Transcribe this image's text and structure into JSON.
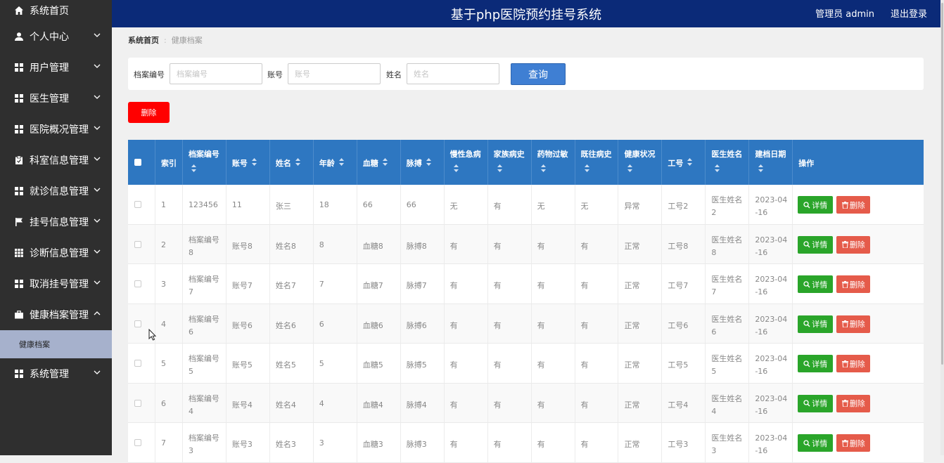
{
  "app": {
    "title": "基于php医院预约挂号系统",
    "user_label": "管理员 admin",
    "logout_label": "退出登录"
  },
  "sidebar": {
    "items": [
      {
        "label": "系统首页",
        "icon": "home-icon"
      },
      {
        "label": "个人中心",
        "icon": "user-icon"
      },
      {
        "label": "用户管理",
        "icon": "grid-icon"
      },
      {
        "label": "医生管理",
        "icon": "grid-icon"
      },
      {
        "label": "医院概况管理",
        "icon": "grid-icon"
      },
      {
        "label": "科室信息管理",
        "icon": "clipboard-icon"
      },
      {
        "label": "就诊信息管理",
        "icon": "grid-icon"
      },
      {
        "label": "挂号信息管理",
        "icon": "flag-icon"
      },
      {
        "label": "诊断信息管理",
        "icon": "table-icon"
      },
      {
        "label": "取消挂号管理",
        "icon": "grid-icon"
      },
      {
        "label": "健康档案管理",
        "icon": "briefcase-icon"
      },
      {
        "label": "系统管理",
        "icon": "grid-icon"
      }
    ],
    "sub_item": "健康档案"
  },
  "breadcrumb": {
    "home": "系统首页",
    "current": "健康档案"
  },
  "search": {
    "label1": "档案编号",
    "placeholder1": "档案编号",
    "label2": "账号",
    "placeholder2": "账号",
    "label3": "姓名",
    "placeholder3": "姓名",
    "query_label": "查询"
  },
  "delete_label": "删除",
  "table": {
    "headers": [
      "索引",
      "档案编号",
      "账号",
      "姓名",
      "年龄",
      "血糖",
      "脉搏",
      "慢性急病",
      "家族病史",
      "药物过敏",
      "既往病史",
      "健康状况",
      "工号",
      "医生姓名",
      "建档日期",
      "操作"
    ],
    "detail_label": "详情",
    "delete_label": "删除",
    "rows": [
      {
        "idx": "1",
        "archive_no": "123456",
        "account": "11",
        "name": "张三",
        "age": "18",
        "sugar": "66",
        "pulse": "66",
        "chronic": "无",
        "family": "有",
        "allergy": "无",
        "history": "无",
        "health": "异常",
        "work_no": "工号2",
        "doctor": "医生姓名\n2",
        "date": "2023-04\n-16"
      },
      {
        "idx": "2",
        "archive_no": "档案编号\n8",
        "account": "账号8",
        "name": "姓名8",
        "age": "8",
        "sugar": "血糖8",
        "pulse": "脉搏8",
        "chronic": "有",
        "family": "有",
        "allergy": "有",
        "history": "有",
        "health": "正常",
        "work_no": "工号8",
        "doctor": "医生姓名\n8",
        "date": "2023-04\n-16"
      },
      {
        "idx": "3",
        "archive_no": "档案编号\n7",
        "account": "账号7",
        "name": "姓名7",
        "age": "7",
        "sugar": "血糖7",
        "pulse": "脉搏7",
        "chronic": "有",
        "family": "有",
        "allergy": "有",
        "history": "有",
        "health": "正常",
        "work_no": "工号7",
        "doctor": "医生姓名\n7",
        "date": "2023-04\n-16"
      },
      {
        "idx": "4",
        "archive_no": "档案编号\n6",
        "account": "账号6",
        "name": "姓名6",
        "age": "6",
        "sugar": "血糖6",
        "pulse": "脉搏6",
        "chronic": "有",
        "family": "有",
        "allergy": "有",
        "history": "有",
        "health": "正常",
        "work_no": "工号6",
        "doctor": "医生姓名\n6",
        "date": "2023-04\n-16"
      },
      {
        "idx": "5",
        "archive_no": "档案编号\n5",
        "account": "账号5",
        "name": "姓名5",
        "age": "5",
        "sugar": "血糖5",
        "pulse": "脉搏5",
        "chronic": "有",
        "family": "有",
        "allergy": "有",
        "history": "有",
        "health": "正常",
        "work_no": "工号5",
        "doctor": "医生姓名\n5",
        "date": "2023-04\n-16"
      },
      {
        "idx": "6",
        "archive_no": "档案编号\n4",
        "account": "账号4",
        "name": "姓名4",
        "age": "4",
        "sugar": "血糖4",
        "pulse": "脉搏4",
        "chronic": "有",
        "family": "有",
        "allergy": "有",
        "history": "有",
        "health": "正常",
        "work_no": "工号4",
        "doctor": "医生姓名\n4",
        "date": "2023-04\n-16"
      },
      {
        "idx": "7",
        "archive_no": "档案编号\n3",
        "account": "账号3",
        "name": "姓名3",
        "age": "3",
        "sugar": "血糖3",
        "pulse": "脉搏3",
        "chronic": "有",
        "family": "有",
        "allergy": "有",
        "history": "有",
        "health": "正常",
        "work_no": "工号3",
        "doctor": "医生姓名\n3",
        "date": "2023-04\n-16"
      }
    ]
  },
  "colors": {
    "topbar": "#0b2a78",
    "sidebar": "#2f2f2f",
    "table_header": "#2e77c1",
    "detail_button": "#2aa52a",
    "delete_button": "#e55b4a",
    "batch_delete": "#ff0000"
  }
}
